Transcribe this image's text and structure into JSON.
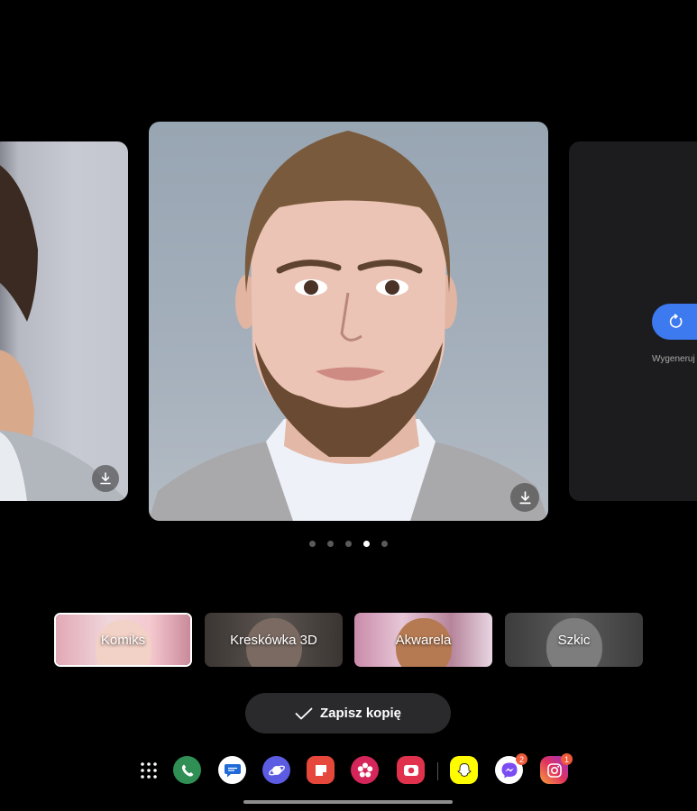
{
  "carousel": {
    "page_count": 5,
    "active_page": 4,
    "regenerate_label": "Wygeneruj"
  },
  "styles": [
    {
      "label": "Komiks",
      "selected": true
    },
    {
      "label": "Kreskówka 3D",
      "selected": false
    },
    {
      "label": "Akwarela",
      "selected": false
    },
    {
      "label": "Szkic",
      "selected": false
    }
  ],
  "save_button": {
    "label": "Zapisz kopię"
  },
  "dock": {
    "apps": [
      {
        "name": "app-drawer-icon"
      },
      {
        "name": "phone-icon",
        "color": "#2f8f55"
      },
      {
        "name": "messages-icon",
        "color": "#ffffff"
      },
      {
        "name": "internet-icon",
        "color": "#5b5ce2"
      },
      {
        "name": "notes-icon",
        "color": "#e5483a"
      },
      {
        "name": "gallery-icon",
        "color": "#d4265a"
      },
      {
        "name": "screen-recorder-icon",
        "color": "#e0324d"
      },
      {
        "name": "snapchat-icon",
        "color": "#fffc00"
      },
      {
        "name": "messenger-icon",
        "color": "#ffffff",
        "badge": "2"
      },
      {
        "name": "instagram-icon",
        "color": "#d62976",
        "badge": "1"
      }
    ]
  }
}
